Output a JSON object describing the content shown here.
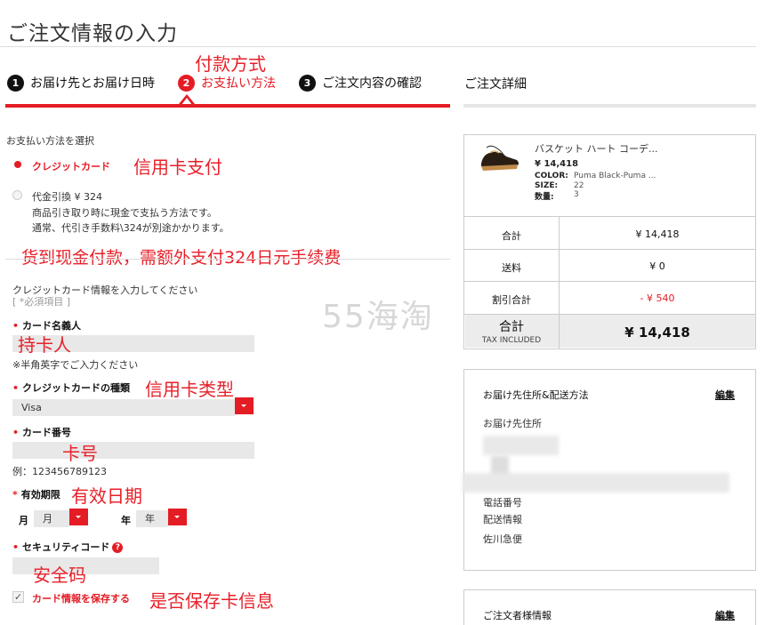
{
  "page_title": "ご注文情報の入力",
  "annotations": {
    "payment_method": "付款方式",
    "credit_card_pay": "信用卡支付",
    "cod_fee": "货到现金付款，需额外支付324日元手续费",
    "cardholder": "持卡人",
    "card_type": "信用卡类型",
    "card_number": "卡号",
    "expiry": "有效日期",
    "security_code": "安全码",
    "save_card": "是否保存卡信息"
  },
  "watermark": "55海淘",
  "steps": [
    {
      "num": "1",
      "label": "お届け先とお届け日時"
    },
    {
      "num": "2",
      "label": "お支払い方法"
    },
    {
      "num": "3",
      "label": "ご注文内容の確認"
    }
  ],
  "order_detail_tab": "ご注文詳細",
  "payment": {
    "heading": "お支払い方法を選択",
    "credit_label": "クレジットカード",
    "cod_label": "代金引換 ¥ 324",
    "cod_desc_1": "商品引き取り時に現金で支払う方法です。",
    "cod_desc_2": "通常、代引き手数料\\324が別途かかります。"
  },
  "card_form": {
    "intro": "クレジットカード情報を入力してください",
    "required_note": "[ *必須項目 ]",
    "holder_label": "カード名義人",
    "holder_hint": "※半角英字でご入力ください",
    "type_label": "クレジットカードの種類",
    "type_value": "Visa",
    "number_label": "カード番号",
    "number_example": "例：123456789123",
    "expiry_label": "有効期限",
    "month_label": "月",
    "month_value": "月",
    "year_label": "年",
    "year_value": "年",
    "security_label": "セキュリティコード",
    "help_glyph": "?",
    "save_label": "カード情報を保存する",
    "save_check": "✓"
  },
  "product": {
    "name": "バスケット ハート コーデ...",
    "price": "¥ 14,418",
    "color_label": "COLOR:",
    "color_value": "Puma Black-Puma ...",
    "size_label": "SIZE:",
    "size_value": "22",
    "qty_label": "数量:",
    "qty_value": "3"
  },
  "summary": {
    "subtotal_label": "合計",
    "subtotal_value": "¥ 14,418",
    "shipping_label": "送料",
    "shipping_value": "¥ 0",
    "discount_label": "割引合計",
    "discount_value": "- ¥ 540",
    "total_label": "合計",
    "total_sub": "TAX INCLUDED",
    "total_value": "¥ 14,418"
  },
  "shipping": {
    "title": "お届け先住所&配送方法",
    "edit": "編集",
    "address_label": "お届け先住所",
    "phone_label": "電話番号",
    "delivery_label": "配送情報",
    "carrier": "佐川急便"
  },
  "customer": {
    "title": "ご注文者様情報",
    "edit": "編集"
  },
  "colors": {
    "accent": "#e41c24"
  }
}
